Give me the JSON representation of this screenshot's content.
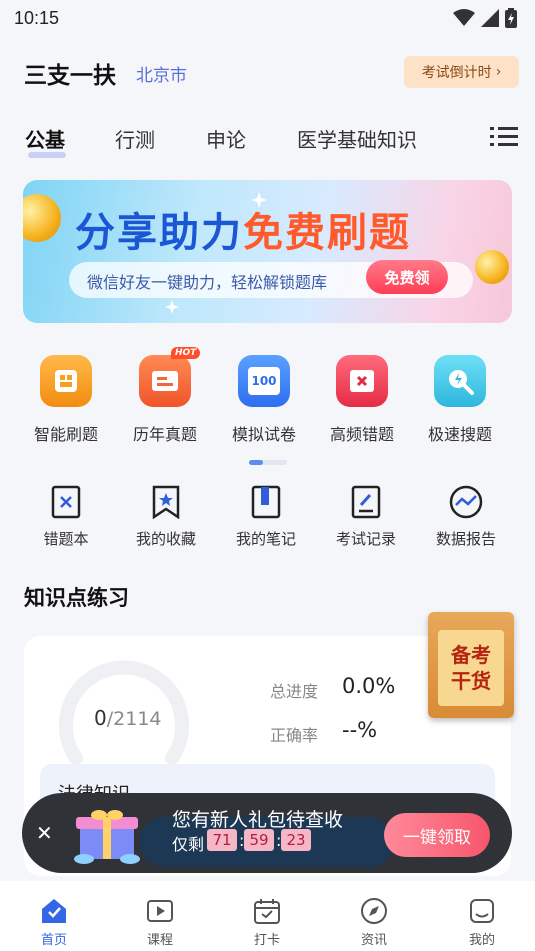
{
  "status_bar": {
    "time": "10:15"
  },
  "header": {
    "app_title": "三支一扶",
    "city": "北京市",
    "countdown_label": "考试倒计时"
  },
  "tabs": [
    {
      "label": "公基",
      "active": true
    },
    {
      "label": "行测",
      "active": false
    },
    {
      "label": "申论",
      "active": false
    },
    {
      "label": "医学基础知识",
      "active": false
    }
  ],
  "banner": {
    "title_part1": "分享助力",
    "title_part2": "免费刷题",
    "subtitle": "微信好友一键助力，轻松解锁题库",
    "cta": "免费领"
  },
  "features": [
    {
      "label": "智能刷题",
      "icon": "smart-practice-icon",
      "color": "#f7a01e"
    },
    {
      "label": "历年真题",
      "icon": "past-exams-icon",
      "color": "#f5673a",
      "badge": "HOT"
    },
    {
      "label": "模拟试卷",
      "icon": "mock-exam-icon",
      "color": "#3a86f5",
      "icon_text": "100"
    },
    {
      "label": "高频错题",
      "icon": "frequent-errors-icon",
      "color": "#f2435a"
    },
    {
      "label": "极速搜题",
      "icon": "quick-search-icon",
      "color": "#3cc7e8"
    }
  ],
  "tools": [
    {
      "label": "错题本",
      "icon": "mistake-book-icon"
    },
    {
      "label": "我的收藏",
      "icon": "bookmark-icon"
    },
    {
      "label": "我的笔记",
      "icon": "notes-icon"
    },
    {
      "label": "考试记录",
      "icon": "exam-record-icon"
    },
    {
      "label": "数据报告",
      "icon": "data-report-icon"
    }
  ],
  "knowledge": {
    "section_title": "知识点练习",
    "done": "0",
    "total": "/2114",
    "progress_label": "总进度",
    "progress_value": "0.0%",
    "accuracy_label": "正确率",
    "accuracy_value": "--%",
    "subject": "法律知识"
  },
  "float_tag": {
    "line1": "备考",
    "line2": "干货"
  },
  "popup": {
    "title": "您有新人礼包待查收",
    "remaining_label": "仅剩",
    "hours": "71",
    "minutes": "59",
    "seconds": "23",
    "button": "一键领取"
  },
  "bottom_nav": [
    {
      "label": "首页",
      "icon": "home-icon",
      "active": true
    },
    {
      "label": "课程",
      "icon": "course-play-icon",
      "active": false
    },
    {
      "label": "打卡",
      "icon": "calendar-checkin-icon",
      "active": false
    },
    {
      "label": "资讯",
      "icon": "compass-news-icon",
      "active": false
    },
    {
      "label": "我的",
      "icon": "profile-icon",
      "active": false
    }
  ],
  "colors": {
    "accent": "#3466e6",
    "banner_blue": "#1a56d6",
    "banner_orange": "#ff5a2a"
  }
}
